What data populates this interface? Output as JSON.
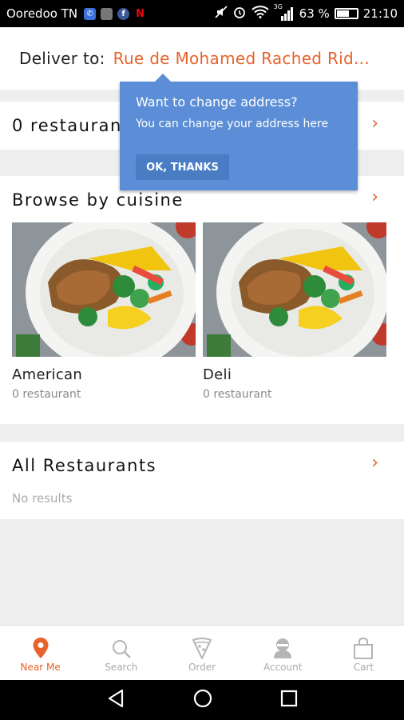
{
  "status_bar": {
    "carrier": "Ooredoo TN",
    "battery_percent": "63 %",
    "battery_level": 0.63,
    "time": "21:10",
    "network": "3G"
  },
  "deliver": {
    "label": "Deliver to:",
    "address": "Rue de Mohamed Rached Rid..."
  },
  "restaurants": {
    "count_text": "0 restaurant"
  },
  "tooltip": {
    "title": "Want to change address?",
    "body": "You can change your address here",
    "button": "OK, THANKS"
  },
  "cuisine": {
    "title": "Browse by cuisine",
    "items": [
      {
        "name": "American",
        "count": "0 restaurant"
      },
      {
        "name": "Deli",
        "count": "0 restaurant"
      }
    ]
  },
  "all_restaurants": {
    "title": "All Restaurants",
    "empty_text": "No results"
  },
  "bottom_nav": [
    {
      "label": "Near Me",
      "icon": "location-pin-icon"
    },
    {
      "label": "Search",
      "icon": "search-icon"
    },
    {
      "label": "Order",
      "icon": "pizza-icon"
    },
    {
      "label": "Account",
      "icon": "account-icon"
    },
    {
      "label": "Cart",
      "icon": "cart-icon"
    }
  ],
  "colors": {
    "accent": "#e8622c",
    "tooltip": "#5b8ed6"
  }
}
